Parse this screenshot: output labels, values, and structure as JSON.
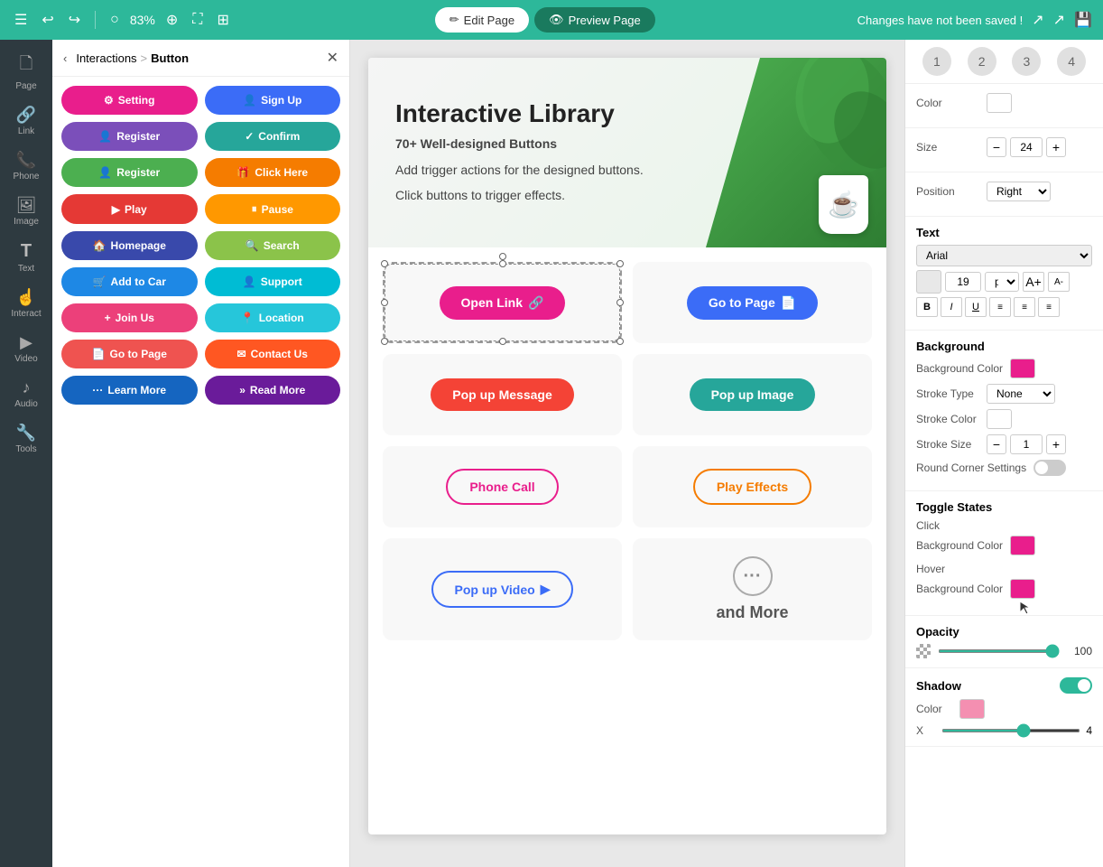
{
  "topbar": {
    "menu_icon": "☰",
    "undo_icon": "↩",
    "redo_icon": "↪",
    "zoom_reset_icon": "○",
    "zoom_percent": "83%",
    "zoom_in_icon": "⊕",
    "fullscreen_icon": "⛶",
    "grid_icon": "⊞",
    "edit_page_label": "Edit Page",
    "preview_page_label": "Preview Page",
    "unsaved_notice": "Changes have not been saved !",
    "export_icon": "↗",
    "share_icon": "↗",
    "save_icon": "💾"
  },
  "sidebar": {
    "items": [
      {
        "id": "page",
        "icon": "🗋",
        "label": "Page"
      },
      {
        "id": "link",
        "icon": "🔗",
        "label": "Link"
      },
      {
        "id": "phone",
        "icon": "📞",
        "label": "Phone"
      },
      {
        "id": "image",
        "icon": "🖼",
        "label": "Image"
      },
      {
        "id": "text",
        "icon": "T",
        "label": "Text"
      },
      {
        "id": "interact",
        "icon": "☝",
        "label": "Interact"
      },
      {
        "id": "video",
        "icon": "▶",
        "label": "Video"
      },
      {
        "id": "audio",
        "icon": "♪",
        "label": "Audio"
      },
      {
        "id": "tools",
        "icon": "🔧",
        "label": "Tools"
      }
    ]
  },
  "panel": {
    "back_label": "Interactions",
    "separator": ">",
    "active_label": "Button",
    "buttons": [
      {
        "id": "setting",
        "label": "Setting",
        "icon": "⚙",
        "style": "pink"
      },
      {
        "id": "sign-up",
        "label": "Sign Up",
        "icon": "👤",
        "style": "blue"
      },
      {
        "id": "register",
        "label": "Register",
        "icon": "👤",
        "style": "purple"
      },
      {
        "id": "confirm",
        "label": "Confirm",
        "icon": "✓",
        "style": "teal"
      },
      {
        "id": "register2",
        "label": "Register",
        "icon": "👤",
        "style": "green"
      },
      {
        "id": "click-here",
        "label": "Click Here",
        "icon": "🎁",
        "style": "orange"
      },
      {
        "id": "play",
        "label": "Play",
        "icon": "▶",
        "style": "red"
      },
      {
        "id": "pause",
        "label": "Pause",
        "icon": "⏸",
        "style": "orange2"
      },
      {
        "id": "homepage",
        "label": "Homepage",
        "icon": "🏠",
        "style": "indigo"
      },
      {
        "id": "search",
        "label": "Search",
        "icon": "🔍",
        "style": "green2"
      },
      {
        "id": "add-to-car",
        "label": "Add to Car",
        "icon": "🛒",
        "style": "blue2"
      },
      {
        "id": "support",
        "label": "Support",
        "icon": "👤",
        "style": "cyan"
      },
      {
        "id": "join-us",
        "label": "Join Us",
        "icon": "+",
        "style": "pink2"
      },
      {
        "id": "location",
        "label": "Location",
        "icon": "📍",
        "style": "teal2"
      },
      {
        "id": "go-to-page",
        "label": "Go to Page",
        "icon": "📄",
        "style": "red2"
      },
      {
        "id": "contact-us",
        "label": "Contact Us",
        "icon": "✉",
        "style": "deeporange"
      },
      {
        "id": "learn-more",
        "label": "Learn More",
        "icon": "···",
        "style": "blue3"
      },
      {
        "id": "read-more",
        "label": "Read More",
        "icon": "»",
        "style": "purple2"
      }
    ]
  },
  "canvas": {
    "hero_title": "Interactive Library",
    "hero_subtitle": "70+ Well-designed Buttons",
    "hero_desc1": "Add trigger actions for the designed buttons.",
    "hero_desc2": "Click buttons to trigger effects.",
    "buttons": {
      "open_link": "Open Link",
      "open_link_icon": "🔗",
      "go_to_page": "Go to Page",
      "go_to_page_icon": "📄",
      "pop_up_message": "Pop up Message",
      "pop_up_image": "Pop up Image",
      "phone_call": "Phone Call",
      "play_effects": "Play Effects",
      "pop_up_video": "Pop up Video",
      "pop_up_video_icon": "▶",
      "and_more": "and More"
    }
  },
  "right_panel": {
    "circles": [
      "1",
      "2",
      "3",
      "4"
    ],
    "color_label": "Color",
    "size_label": "Size",
    "size_value": "24",
    "position_label": "Position",
    "position_value": "Right",
    "text_section_label": "Text",
    "font_name": "Arial",
    "font_size": "19",
    "background_section_label": "Background",
    "background_color_label": "Background Color",
    "stroke_type_label": "Stroke Type",
    "stroke_type_value": "None",
    "stroke_color_label": "Stroke Color",
    "stroke_size_label": "Stroke Size",
    "stroke_size_value": "1",
    "round_corner_label": "Round Corner Settings",
    "toggle_states_label": "Toggle States",
    "click_label": "Click",
    "click_bg_color_label": "Background Color",
    "hover_label": "Hover",
    "hover_bg_color_label": "Background Color",
    "opacity_label": "Opacity",
    "opacity_value": "100",
    "shadow_label": "Shadow",
    "shadow_color_label": "Color",
    "shadow_x_label": "X",
    "shadow_x_value": "4"
  }
}
